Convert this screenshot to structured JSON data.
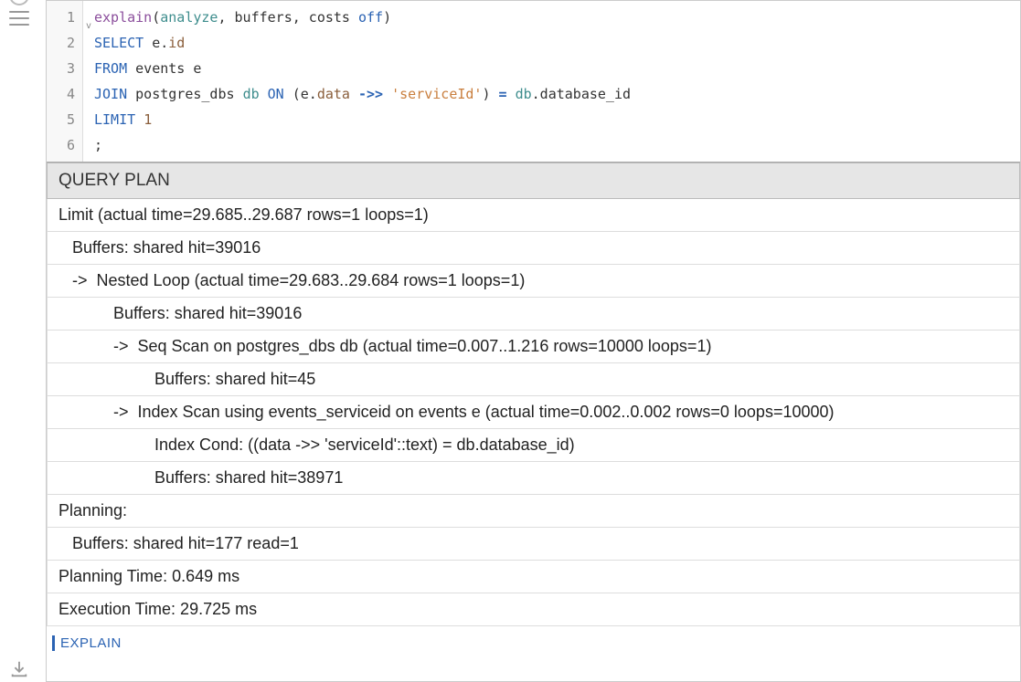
{
  "editor": {
    "lines": [
      {
        "num": "1",
        "segments": [
          {
            "cls": "kw-explain",
            "text": "explain"
          },
          {
            "cls": "plain",
            "text": "("
          },
          {
            "cls": "kw-teal",
            "text": "analyze"
          },
          {
            "cls": "plain",
            "text": ", buffers, costs "
          },
          {
            "cls": "kw-blue",
            "text": "off"
          },
          {
            "cls": "plain",
            "text": ")"
          }
        ]
      },
      {
        "num": "2",
        "segments": [
          {
            "cls": "kw-blue",
            "text": "SELECT"
          },
          {
            "cls": "plain",
            "text": " e."
          },
          {
            "cls": "kw-brown",
            "text": "id"
          }
        ]
      },
      {
        "num": "3",
        "segments": [
          {
            "cls": "kw-blue",
            "text": "FROM"
          },
          {
            "cls": "plain",
            "text": " events e"
          }
        ]
      },
      {
        "num": "4",
        "segments": [
          {
            "cls": "kw-blue",
            "text": "JOIN"
          },
          {
            "cls": "plain",
            "text": " postgres_dbs "
          },
          {
            "cls": "kw-teal",
            "text": "db"
          },
          {
            "cls": "plain",
            "text": " "
          },
          {
            "cls": "kw-blue",
            "text": "ON"
          },
          {
            "cls": "plain",
            "text": " (e."
          },
          {
            "cls": "kw-brown",
            "text": "data"
          },
          {
            "cls": "plain",
            "text": " "
          },
          {
            "cls": "kw-op",
            "text": "->>"
          },
          {
            "cls": "plain",
            "text": " "
          },
          {
            "cls": "kw-string",
            "text": "'serviceId'"
          },
          {
            "cls": "plain",
            "text": ") "
          },
          {
            "cls": "kw-op",
            "text": "="
          },
          {
            "cls": "plain",
            "text": " "
          },
          {
            "cls": "kw-teal",
            "text": "db"
          },
          {
            "cls": "plain",
            "text": ".database_id"
          }
        ]
      },
      {
        "num": "5",
        "segments": [
          {
            "cls": "kw-blue",
            "text": "LIMIT"
          },
          {
            "cls": "plain",
            "text": " "
          },
          {
            "cls": "kw-brown",
            "text": "1"
          }
        ]
      },
      {
        "num": "6",
        "segments": [
          {
            "cls": "plain",
            "text": ";"
          }
        ]
      }
    ],
    "marker": "v"
  },
  "results": {
    "header": "QUERY PLAN",
    "rows": [
      "Limit (actual time=29.685..29.687 rows=1 loops=1)",
      "   Buffers: shared hit=39016",
      "   ->  Nested Loop (actual time=29.683..29.684 rows=1 loops=1)",
      "            Buffers: shared hit=39016",
      "            ->  Seq Scan on postgres_dbs db (actual time=0.007..1.216 rows=10000 loops=1)",
      "                     Buffers: shared hit=45",
      "            ->  Index Scan using events_serviceid on events e (actual time=0.002..0.002 rows=0 loops=10000)",
      "                     Index Cond: ((data ->> 'serviceId'::text) = db.database_id)",
      "                     Buffers: shared hit=38971",
      "Planning:",
      "   Buffers: shared hit=177 read=1",
      "Planning Time: 0.649 ms",
      "Execution Time: 29.725 ms"
    ]
  },
  "footer": {
    "explain_label": "EXPLAIN"
  }
}
